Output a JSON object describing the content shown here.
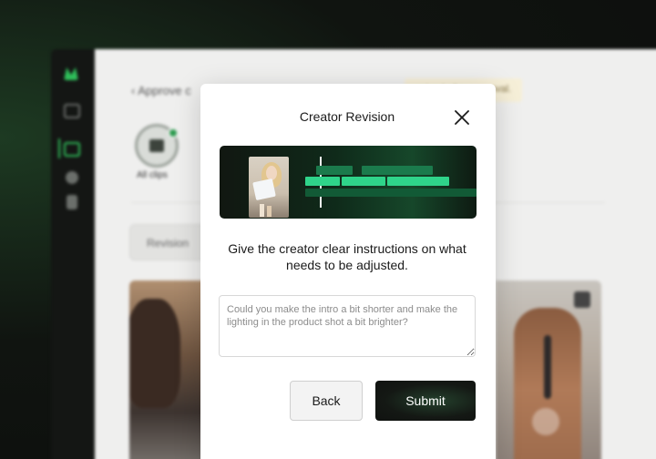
{
  "background": {
    "back_link": "‹ Approve c",
    "notice": "nsived after approval.",
    "clips_label": "All clips",
    "chip_label": "Revision"
  },
  "modal": {
    "title": "Creator Revision",
    "instructions": "Give the creator clear instructions on what needs to be adjusted.",
    "textarea_placeholder": "Could you make the intro a bit shorter and make the lighting in the product shot a bit brighter?",
    "back_label": "Back",
    "submit_label": "Submit"
  },
  "colors": {
    "accent_green": "#2fd48a",
    "dark_green": "#1b7a4c",
    "submit_bg": "#141814",
    "modal_bg": "#ffffff"
  },
  "icons": {
    "close": "close-icon",
    "logo": "brand-logo-icon",
    "camera": "video-camera-icon",
    "play": "play-icon"
  }
}
